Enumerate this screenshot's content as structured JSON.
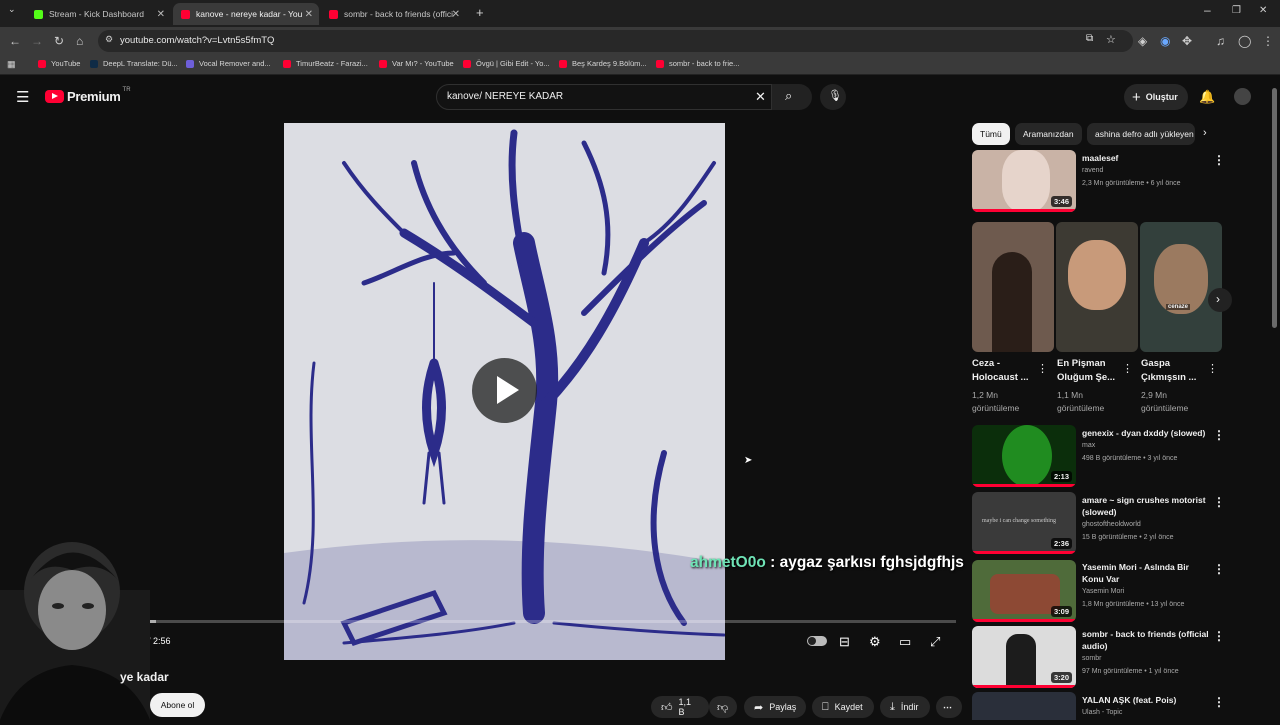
{
  "browser": {
    "tabs": [
      {
        "label": "Stream - Kick Dashboard",
        "color": "#53fc18"
      },
      {
        "label": "kanove - nereye kadar - YouTube",
        "color": "#ff0033"
      },
      {
        "label": "sombr - back to friends (official",
        "color": "#ff0033"
      }
    ],
    "url": "youtube.com/watch?v=Lvtn5s5fmTQ",
    "bookmarks": [
      "YouTube",
      "DeepL Translate: Dü...",
      "Vocal Remover and...",
      "TimurBeatz - Farazi...",
      "Var Mı? - YouTube",
      "Övgü | Gibi Edit - Yo...",
      "Beş Kardeş 9.Bölüm...",
      "sombr - back to frie..."
    ]
  },
  "header": {
    "logo": "Premium",
    "region": "TR",
    "search_value": "kanove/ NEREYE KADAR",
    "create_label": "Oluştur"
  },
  "player": {
    "time": "0:00 / 2:56",
    "progress_fraction": 0.0
  },
  "overlay": {
    "chat_user": "ahmetO0o",
    "chat_message": " : aygaz şarkısı fghsjdgfhjs"
  },
  "video_info": {
    "title_partial": "ye kadar",
    "subscribe_label": "Abone ol",
    "likes": "1,1 B",
    "share_label": "Paylaş",
    "save_label": "Kaydet",
    "download_label": "İndir"
  },
  "sidebar": {
    "chips": [
      "Tümü",
      "Aramanızdan",
      "ashina defro adlı yükleyen"
    ],
    "first": {
      "title": "maalesef",
      "channel": "ravend",
      "meta": "2,3 Mn görüntüleme • 6 yıl önce",
      "duration": "3:46"
    },
    "shorts": [
      {
        "title": "Ceza - Holocaust ...",
        "views1": "1,2 Mn",
        "views2": "görüntüleme"
      },
      {
        "title": "En Pişman Oluğum Şe...",
        "views1": "1,1 Mn",
        "views2": "görüntüleme"
      },
      {
        "title": "Gaspa Çıkmışsın ...",
        "views1": "2,9 Mn",
        "views2": "görüntüleme",
        "badge": "cenaze"
      }
    ],
    "videos": [
      {
        "title": "genexix - dyan dxddy (slowed)",
        "channel": "max",
        "meta": "498 B görüntüleme • 3 yıl önce",
        "duration": "2:13"
      },
      {
        "title": "amare ~ sign crushes motorist (slowed)",
        "channel": "ghostoftheoldworld",
        "meta": "15 B görüntüleme • 2 yıl önce",
        "duration": "2:36",
        "thumb_text": "maybe i can change something"
      },
      {
        "title": "Yasemin Mori - Aslında Bir Konu Var",
        "channel": "Yasemin Mori",
        "meta": "1,8 Mn görüntüleme • 13 yıl önce",
        "duration": "3:09"
      },
      {
        "title": "sombr - back to friends (official audio)",
        "channel": "sombr",
        "meta": "97 Mn görüntüleme • 1 yıl önce",
        "duration": "3:20"
      },
      {
        "title": "YALAN AŞK (feat. Pois)",
        "channel": "Ulash - Topic",
        "meta": "",
        "duration": ""
      }
    ]
  }
}
